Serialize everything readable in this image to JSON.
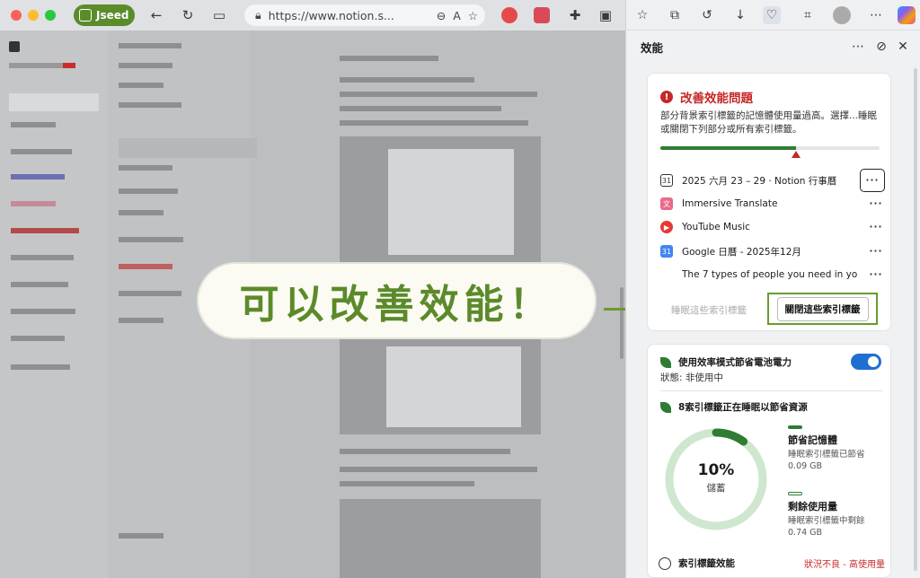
{
  "browser": {
    "profile_name": "Jseed",
    "url": "https://www.notion.s..."
  },
  "overlay": {
    "callout_text": "可以改善效能！"
  },
  "panel": {
    "title": "效能",
    "issue": {
      "title": "改善效能問題",
      "description": "部分背景索引標籤的記憶體使用量過高。選擇...睡眠或關閉下列部分或所有索引標籤。",
      "memory_usage_fraction": 0.62,
      "tabs": [
        {
          "icon": "calendar-icon",
          "label": "2025 六月 23 – 29 · Notion 行事曆"
        },
        {
          "icon": "translate-icon",
          "label": "Immersive Translate"
        },
        {
          "icon": "youtube-music-icon",
          "label": "YouTube Music"
        },
        {
          "icon": "google-calendar-icon",
          "label": "Google 日曆 - 2025年12月"
        },
        {
          "icon": "blank-tab-icon",
          "label": "The 7 types of people you need in yo..."
        }
      ],
      "more_label": "···",
      "sleep_link": "睡眠這些索引標籤",
      "close_button": "關閉這些索引標籤"
    },
    "efficiency": {
      "title": "使用效率模式節省電池電力",
      "status": "狀態: 非使用中",
      "enabled": true
    },
    "sleeping": {
      "title": "8索引標籤正在睡眠以節省資源",
      "saved_percent": "10%",
      "saved_label": "儲蓄",
      "saved_fraction": 0.1,
      "memory_saved_title": "節省記憶體",
      "memory_saved_sub": "睡眠索引標籤已節省",
      "memory_saved_value": "0.09 GB",
      "remaining_title": "剩餘使用量",
      "remaining_sub": "睡眠索引標籤中剩餘",
      "remaining_value": "0.74 GB"
    },
    "tab_performance": {
      "title": "索引標籤效能",
      "status": "狀況不良 - 高使用量"
    }
  },
  "colors": {
    "accent_green": "#5c8a2a",
    "warning_red": "#c62828",
    "toggle_blue": "#1f6fd1",
    "saved_green": "#2e7d32"
  }
}
